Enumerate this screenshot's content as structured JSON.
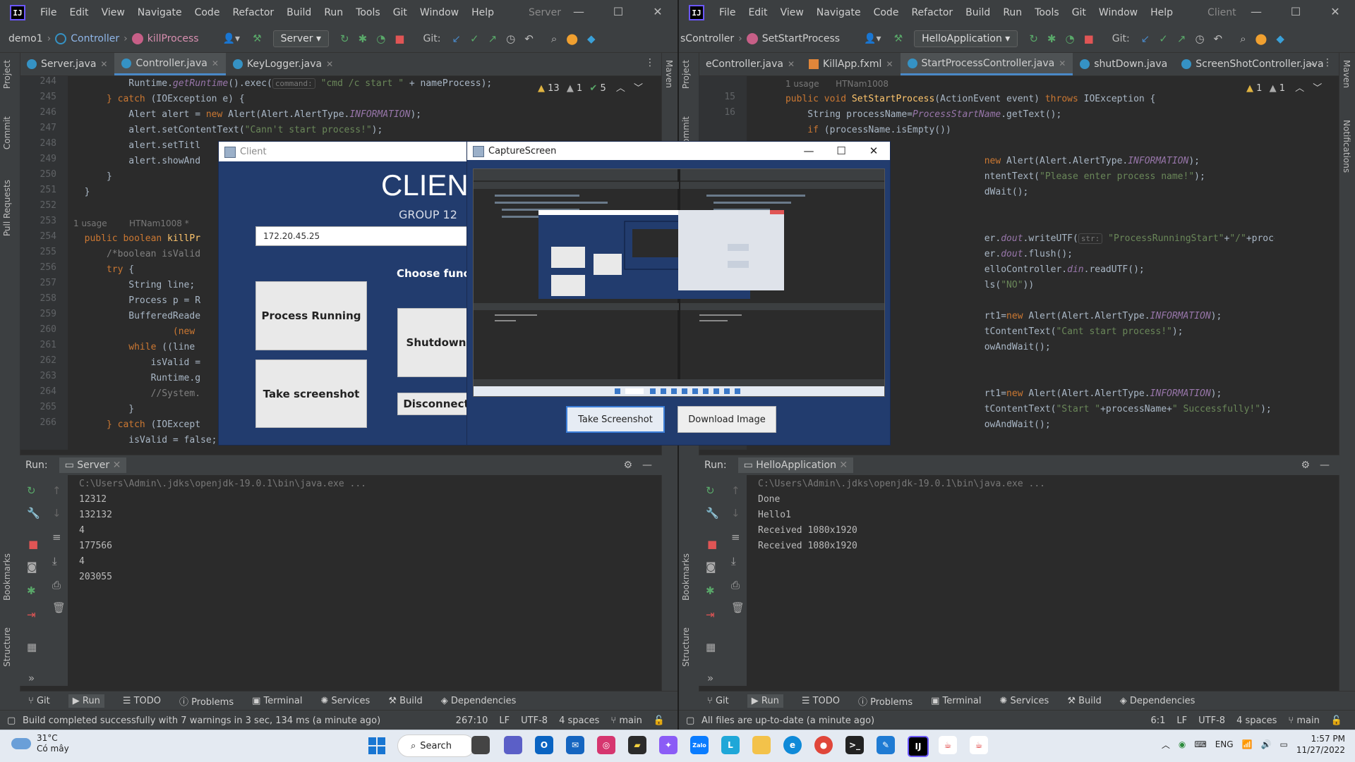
{
  "colors": {
    "ide_bg": "#2b2b2b",
    "ide_panel": "#3c3f41",
    "client_bg": "#223c6e",
    "accent": "#4a88c7"
  },
  "menu": [
    "File",
    "Edit",
    "View",
    "Navigate",
    "Code",
    "Refactor",
    "Build",
    "Run",
    "Tools",
    "Git",
    "Window",
    "Help"
  ],
  "left_ide": {
    "window_title": "Server",
    "breadcrumb": [
      "demo1",
      "Controller",
      "killProcess"
    ],
    "run_config": "Server",
    "git_label": "Git:",
    "tabs": [
      {
        "label": "Server.java",
        "active": false
      },
      {
        "label": "Controller.java",
        "active": true
      },
      {
        "label": "KeyLogger.java",
        "active": false
      }
    ],
    "inspections": {
      "warnings": "13",
      "weak": "1",
      "ok": "5"
    },
    "line_numbers": [
      "244",
      "245",
      "246",
      "247",
      "248",
      "249",
      "250",
      "251",
      "252",
      "253",
      "254",
      "255",
      "256",
      "257",
      "258",
      "259",
      "260",
      "261",
      "262",
      "263",
      "264",
      "265",
      "266"
    ],
    "code": {
      "l244_a": "Runtime.",
      "l244_b": "getRuntime",
      "l244_c": "().exec(",
      "l244_hint": "command:",
      "l244_str": "\"cmd /c start \"",
      "l244_d": " + nameProcess);",
      "l245_kw": "} catch",
      "l245_rest": " (IOException e) {",
      "l246_a": "Alert alert = ",
      "l246_kw": "new",
      "l246_b": " Alert(Alert.AlertType.",
      "l246_it": "INFORMATION",
      "l246_c": ");",
      "l247_a": "alert.setContentText(",
      "l247_str": "\"Cann't start process!\"",
      "l247_b": ");",
      "l248": "alert.setTitl",
      "l249": "alert.showAnd",
      "l250": "}",
      "l251": "}",
      "usage": "1 usage",
      "author": "HTNam1008 *",
      "l253_kw": "public boolean",
      "l253_fn": " killPr",
      "l254_cm": "/*boolean isValid",
      "l255_kw": "try",
      "l255_rest": " {",
      "l256": "String line;",
      "l257": "Process p = R",
      "l258": "BufferedReade",
      "l259_kw": "(new",
      "l260_kw": "while",
      "l260_rest": " ((line",
      "l261": "isValid =",
      "l262": "Runtime.g",
      "l263_cm": "//System.",
      "l264": "}",
      "l265_kw": "} catch",
      "l265_rest": " (IOExcept",
      "l266": "isValid = false;"
    },
    "run_label": "Run:",
    "run_tab": "Server",
    "console": [
      "C:\\Users\\Admin\\.jdks\\openjdk-19.0.1\\bin\\java.exe ...",
      "12312",
      "132132",
      "4",
      "177566",
      "4",
      "203055"
    ],
    "bottom_tabs": [
      "Git",
      "Run",
      "TODO",
      "Problems",
      "Terminal",
      "Services",
      "Build",
      "Dependencies"
    ],
    "status_msg": "Build completed successfully with 7 warnings in 3 sec, 134 ms (a minute ago)",
    "status_right": [
      "267:10",
      "LF",
      "UTF-8",
      "4 spaces",
      "main"
    ],
    "strip_left": [
      "Project",
      "Commit",
      "Pull Requests",
      "Bookmarks",
      "Structure"
    ],
    "strip_right": [
      "Maven"
    ]
  },
  "right_ide": {
    "window_title": "Client",
    "breadcrumb": [
      "sController",
      "SetStartProcess"
    ],
    "run_config": "HelloApplication",
    "git_label": "Git:",
    "tabs": [
      {
        "label": "eController.java",
        "active": false
      },
      {
        "label": "KillApp.fxml",
        "active": false
      },
      {
        "label": "StartProcessController.java",
        "active": true
      },
      {
        "label": "shutDown.java",
        "active": false
      },
      {
        "label": "ScreenShotController.java",
        "active": false
      }
    ],
    "inspections": {
      "warnings": "1",
      "weak": "1"
    },
    "line_numbers": [
      "",
      "15",
      "16"
    ],
    "code": {
      "usage": "1 usage",
      "author": "HTNam1008",
      "l14_kw": "public void",
      "l14_fn": " SetStartProcess",
      "l14_a": "(ActionEvent event) ",
      "l14_kw2": "throws",
      "l14_b": " IOException {",
      "l15_a": "String processName=",
      "l15_it": "ProcessStartName",
      "l15_b": ".getText();",
      "l16_kw": "if",
      "l16_rest": " (processName.isEmpty())",
      "l18_kw": "new",
      "l18_a": " Alert(Alert.AlertType.",
      "l18_it": "INFORMATION",
      "l18_b": ");",
      "l19_a": "ntentText(",
      "l19_str": "\"Please enter process name!\"",
      "l19_b": ");",
      "l20": "dWait();",
      "l23_a": "er.",
      "l23_it": "dout",
      "l23_b": ".writeUTF(",
      "l23_hint": "str:",
      "l23_str": "\"ProcessRunningStart\"",
      "l23_c": "+",
      "l23_str2": "\"/\"",
      "l23_d": "+processName);",
      "l24_a": "er.",
      "l24_it": "dout",
      "l24_b": ".flush();",
      "l25_a": "elloController.",
      "l25_it": "din",
      "l25_b": ".readUTF();",
      "l26_a": "ls(",
      "l26_str": "\"NO\"",
      "l26_b": "))",
      "l28_a": "rt1=",
      "l28_kw": "new",
      "l28_b": " Alert(Alert.AlertType.",
      "l28_it": "INFORMATION",
      "l28_c": ");",
      "l29_a": "tContentText(",
      "l29_str": "\"Cant start process!\"",
      "l29_b": ");",
      "l30": "owAndWait();",
      "l33_a": "rt1=",
      "l33_kw": "new",
      "l33_b": " Alert(Alert.AlertType.",
      "l33_it": "INFORMATION",
      "l33_c": ");",
      "l34_a": "tContentText(",
      "l34_str": "\"Start \"",
      "l34_b": "+processName+",
      "l34_str2": "\" Successfully!\"",
      "l34_c": ");",
      "l35": "owAndWait();"
    },
    "run_label": "Run:",
    "run_tab": "HelloApplication",
    "console": [
      "C:\\Users\\Admin\\.jdks\\openjdk-19.0.1\\bin\\java.exe ...",
      "Done",
      "Hello1",
      "Received 1080x1920",
      "Received 1080x1920"
    ],
    "bottom_tabs": [
      "Git",
      "Run",
      "TODO",
      "Problems",
      "Terminal",
      "Services",
      "Build",
      "Dependencies"
    ],
    "status_msg": "All files are up-to-date (a minute ago)",
    "status_right": [
      "6:1",
      "LF",
      "UTF-8",
      "4 spaces",
      "main"
    ],
    "strip_left": [
      "Project",
      "Commit",
      "Bookmarks",
      "Structure"
    ],
    "strip_right": [
      "Maven",
      "Notifications"
    ]
  },
  "client_window": {
    "title": "Client",
    "heading": "CLIENT",
    "subheading": "GROUP 12",
    "ip_value": "172.20.45.25",
    "choose_label": "Choose functi",
    "buttons": {
      "process_running": "Process Running",
      "take_screenshot": "Take screenshot",
      "shutdown": "Shutdown",
      "disconnect": "Disconnect"
    }
  },
  "capture_window": {
    "title": "CaptureScreen",
    "take_screenshot": "Take Screenshot",
    "download_image": "Download Image"
  },
  "taskbar": {
    "temp": "31°C",
    "weather": "Có mây",
    "search": "Search",
    "lang": "ENG",
    "time": "1:57 PM",
    "date": "11/27/2022"
  }
}
